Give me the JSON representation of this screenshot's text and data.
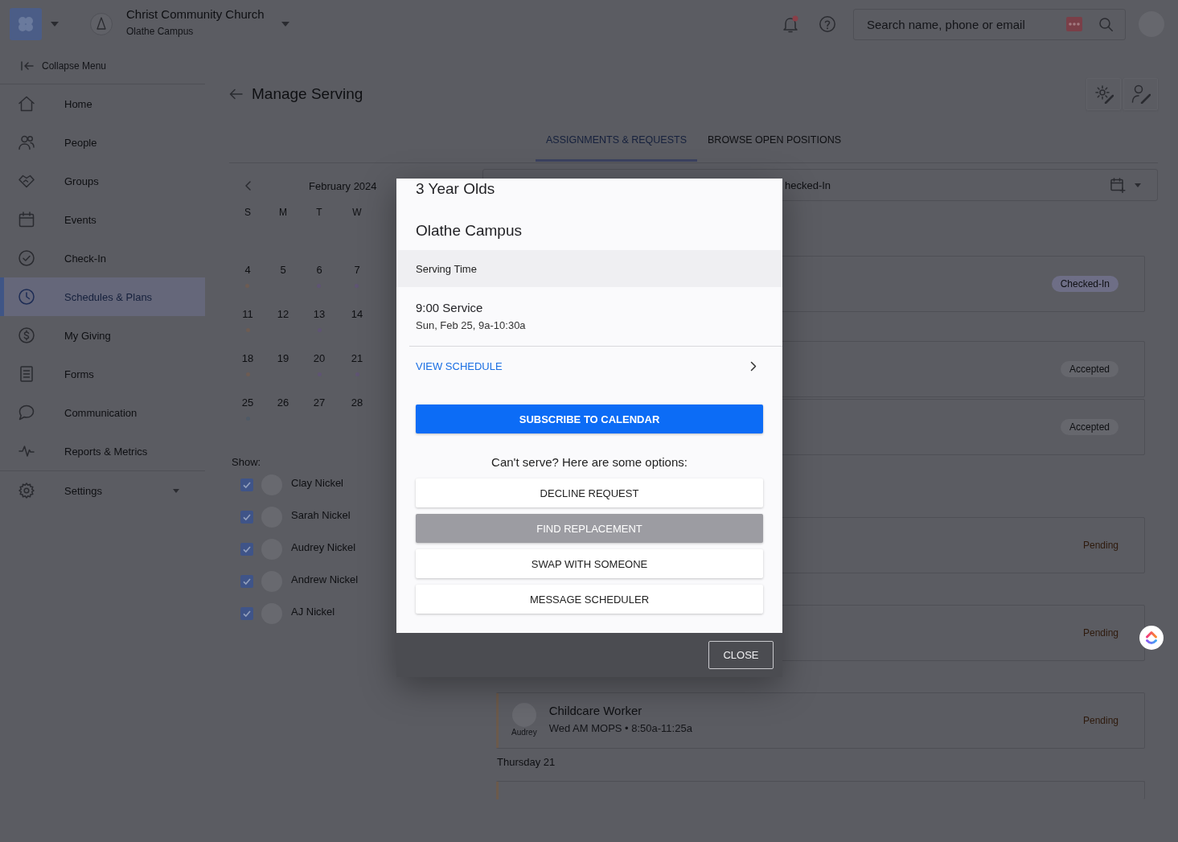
{
  "header": {
    "org_name": "Christ Community Church",
    "campus": "Olathe Campus",
    "notifications": {
      "unread": true
    },
    "search": {
      "placeholder": "Search name, phone or email"
    }
  },
  "sidebar": {
    "collapse_label": "Collapse Menu",
    "items": [
      {
        "label": "Home",
        "kind": "link",
        "selected": false
      },
      {
        "label": "People",
        "kind": "link",
        "selected": false
      },
      {
        "label": "Groups",
        "kind": "link",
        "selected": false
      },
      {
        "label": "Events",
        "kind": "link",
        "selected": false
      },
      {
        "label": "Check-In",
        "kind": "link",
        "selected": false
      },
      {
        "label": "Schedules & Plans",
        "kind": "link",
        "selected": true
      },
      {
        "label": "My Giving",
        "kind": "link",
        "selected": false
      },
      {
        "label": "Forms",
        "kind": "link",
        "selected": false
      },
      {
        "label": "Communication",
        "kind": "link",
        "selected": false
      },
      {
        "label": "Reports & Metrics",
        "kind": "link",
        "selected": false
      },
      {
        "label": "Settings",
        "kind": "group",
        "selected": false
      }
    ]
  },
  "page": {
    "title": "Manage Serving",
    "tabs": [
      {
        "label": "ASSIGNMENTS & REQUESTS",
        "selected": true
      },
      {
        "label": "BROWSE OPEN POSITIONS",
        "selected": false
      }
    ]
  },
  "calendar": {
    "month": "February 2024",
    "weekdays": [
      "S",
      "M",
      "T",
      "W"
    ],
    "weeks": [
      [
        {
          "day": "4",
          "color": "#6d5c53"
        },
        {
          "day": "5"
        },
        {
          "day": "6",
          "color": "#5f5473"
        },
        {
          "day": "7",
          "color": "#5f5473"
        }
      ],
      [
        {
          "day": "11",
          "color": "#6d5c53"
        },
        {
          "day": "12"
        },
        {
          "day": "13",
          "color": "#5f5473"
        },
        {
          "day": "14"
        }
      ],
      [
        {
          "day": "18",
          "color": "#6d5c53"
        },
        {
          "day": "19"
        },
        {
          "day": "20",
          "color": "#5f5473"
        },
        {
          "day": "21",
          "color": "#5f5473"
        }
      ],
      [
        {
          "day": "25",
          "color": "#4f5a66"
        },
        {
          "day": "26"
        },
        {
          "day": "27"
        },
        {
          "day": "28"
        }
      ]
    ]
  },
  "show": {
    "label": "Show:",
    "people": [
      {
        "name": "Clay Nickel",
        "checked": true
      },
      {
        "name": "Sarah Nickel",
        "checked": true
      },
      {
        "name": "Audrey Nickel",
        "checked": true
      },
      {
        "name": "Andrew Nickel",
        "checked": true
      },
      {
        "name": "AJ Nickel",
        "checked": true
      }
    ]
  },
  "schedule": {
    "filter_label": "hecked-In",
    "entries": [
      {
        "kind": "assignment",
        "status": {
          "label": "Checked-In",
          "kind": "checked_in"
        }
      },
      {
        "kind": "assignment",
        "status": {
          "label": "Accepted",
          "kind": "accepted"
        }
      },
      {
        "kind": "assignment",
        "status": {
          "label": "Accepted",
          "kind": "accepted"
        }
      },
      {
        "kind": "assignment",
        "status": {
          "label": "Pending",
          "kind": "pending"
        }
      },
      {
        "kind": "assignment",
        "status": {
          "label": "Pending",
          "kind": "pending"
        }
      },
      {
        "kind": "assignment",
        "color": "#6b5a4c",
        "person": "Audrey",
        "role": "Childcare Worker",
        "detail": "Wed AM MOPS • 8:50a-11:25a",
        "status": {
          "label": "Pending",
          "kind": "pending"
        }
      },
      {
        "kind": "day",
        "label": "Thursday 21"
      },
      {
        "kind": "assignment",
        "color": "#6b5a4c"
      }
    ]
  },
  "modal": {
    "title": "3 Year Olds",
    "campus": "Olathe Campus",
    "section_label": "Serving Time",
    "service": {
      "name": "9:00 Service",
      "when": "Sun, Feb 25, 9a-10:30a"
    },
    "view_schedule": "VIEW SCHEDULE",
    "subscribe": "SUBSCRIBE TO CALENDAR",
    "options_prompt": "Can't serve? Here are some options:",
    "options": [
      {
        "label": "DECLINE REQUEST",
        "disabled": false
      },
      {
        "label": "FIND REPLACEMENT",
        "disabled": true
      },
      {
        "label": "SWAP WITH SOMEONE",
        "disabled": false
      },
      {
        "label": "MESSAGE SCHEDULER",
        "disabled": false
      }
    ],
    "close": "CLOSE"
  }
}
